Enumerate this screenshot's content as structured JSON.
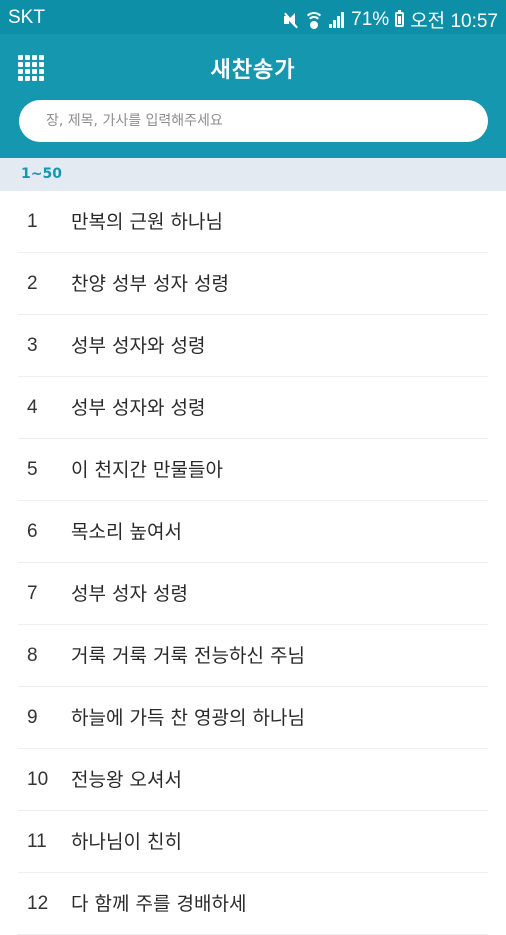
{
  "status_bar": {
    "carrier": "SKT",
    "battery": "71%",
    "time": "오전 10:57",
    "icons": [
      "mute-icon",
      "wifi-icon",
      "signal-icon",
      "battery-icon"
    ]
  },
  "appbar": {
    "menu_icon": "grid-menu-icon",
    "title": "새찬송가",
    "search_placeholder": "장, 제목, 가사를 입력해주세요",
    "search_value": ""
  },
  "section": {
    "label": "1~50"
  },
  "hymns": [
    {
      "num": "1",
      "title": "만복의 근원 하나님"
    },
    {
      "num": "2",
      "title": "찬양 성부 성자 성령"
    },
    {
      "num": "3",
      "title": "성부 성자와 성령"
    },
    {
      "num": "4",
      "title": "성부 성자와 성령"
    },
    {
      "num": "5",
      "title": "이 천지간 만물들아"
    },
    {
      "num": "6",
      "title": "목소리 높여서"
    },
    {
      "num": "7",
      "title": "성부 성자 성령"
    },
    {
      "num": "8",
      "title": "거룩 거룩 거룩 전능하신 주님"
    },
    {
      "num": "9",
      "title": "하늘에 가득 찬 영광의 하나님"
    },
    {
      "num": "10",
      "title": "전능왕 오셔서"
    },
    {
      "num": "11",
      "title": "하나님이 친히"
    },
    {
      "num": "12",
      "title": "다 함께 주를 경배하세"
    }
  ],
  "colors": {
    "primary": "#1597b0",
    "statusbar": "#0e8fa8",
    "section_bg": "#e3eaf2"
  }
}
